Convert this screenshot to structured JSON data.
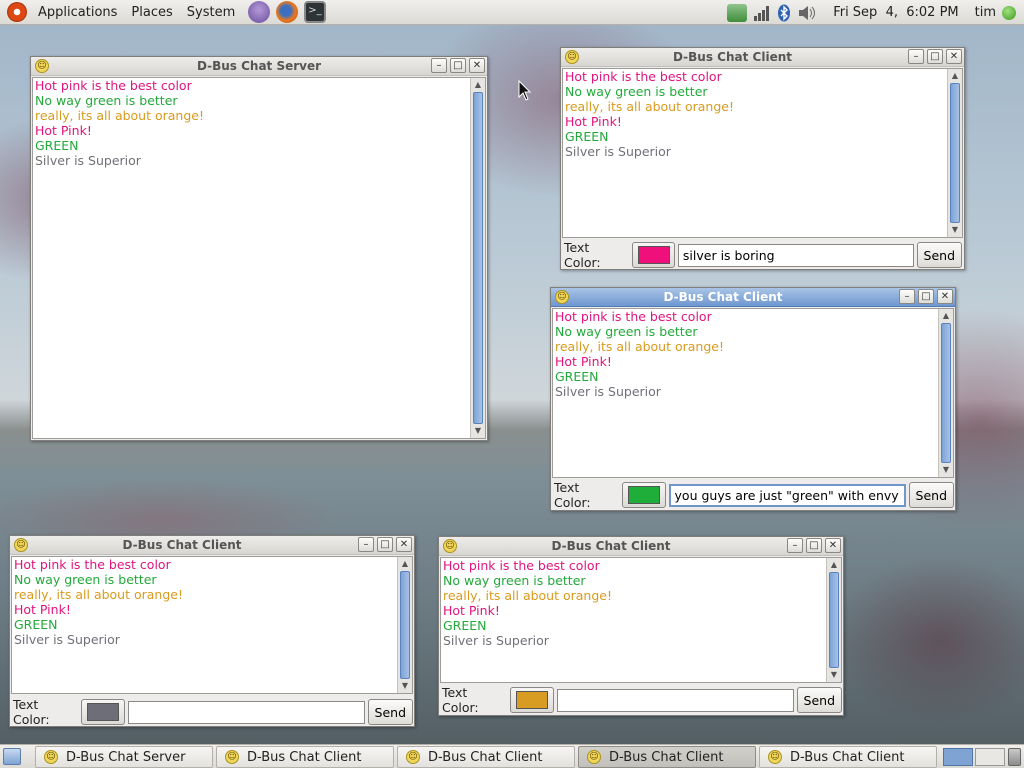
{
  "top_panel": {
    "menus": [
      "Applications",
      "Places",
      "System"
    ],
    "clock": "Fri Sep  4,  6:02 PM",
    "user": "tim"
  },
  "colors": {
    "pink": "#e0147d",
    "green": "#23a83b",
    "orange": "#d89b1e",
    "silver": "#707078"
  },
  "messages": [
    {
      "text": "Hot pink is the best color",
      "color": "#e0147d"
    },
    {
      "text": "No way green is better",
      "color": "#23a83b"
    },
    {
      "text": "really, its all about orange!",
      "color": "#d89b1e"
    },
    {
      "text": "Hot Pink!",
      "color": "#e0147d"
    },
    {
      "text": "GREEN",
      "color": "#23a83b"
    },
    {
      "text": "Silver is Superior",
      "color": "#707078"
    }
  ],
  "server": {
    "title": "D-Bus Chat Server"
  },
  "clients": [
    {
      "title": "D-Bus Chat Client",
      "label": "Text Color:",
      "swatch": "#f0107c",
      "entry": "silver is boring",
      "send": "Send"
    },
    {
      "title": "D-Bus Chat Client",
      "label": "Text Color:",
      "swatch": "#1fae3a",
      "entry": "you guys are just \"green\" with envy",
      "send": "Send"
    },
    {
      "title": "D-Bus Chat Client",
      "label": "Text Color:",
      "swatch": "#6e6e78",
      "entry": "",
      "send": "Send"
    },
    {
      "title": "D-Bus Chat Client",
      "label": "Text Color:",
      "swatch": "#d99c22",
      "entry": "",
      "send": "Send"
    }
  ],
  "taskbar": [
    {
      "label": "D-Bus Chat Server"
    },
    {
      "label": "D-Bus Chat Client"
    },
    {
      "label": "D-Bus Chat Client"
    },
    {
      "label": "D-Bus Chat Client"
    },
    {
      "label": "D-Bus Chat Client"
    }
  ]
}
